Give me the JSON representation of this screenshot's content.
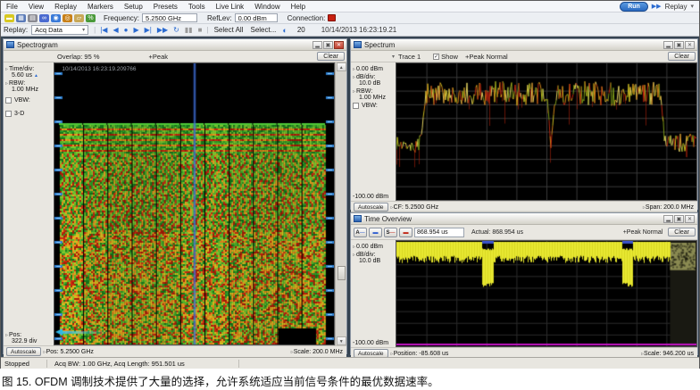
{
  "icons": {
    "caret": "▾",
    "check": "✓",
    "disc": "▹",
    "spin_up": "▲",
    "spin_down": "▼",
    "half_circle": "◐",
    "replay_play": "▶▶",
    "scroll_up": "▲",
    "scroll_down": "▼",
    "dropdown_caret": "▾"
  },
  "menu": {
    "items": [
      "File",
      "View",
      "Replay",
      "Markers",
      "Setup",
      "Presets",
      "Tools",
      "Live Link",
      "Window",
      "Help"
    ],
    "run_button": "Run",
    "replay_button": "Replay"
  },
  "toolbar_icons": [
    {
      "glyph": "▬",
      "name": "marker-peak",
      "color": "#d8c820"
    },
    {
      "glyph": "▦",
      "name": "save",
      "color": "#5a7ab8"
    },
    {
      "glyph": "▤",
      "name": "print",
      "color": "#8a8a92"
    },
    {
      "glyph": "∞",
      "name": "link",
      "color": "#4a6ad0"
    },
    {
      "glyph": "◉",
      "name": "acquire",
      "color": "#3a7ad8"
    },
    {
      "glyph": "◎",
      "name": "search",
      "color": "#c88018"
    },
    {
      "glyph": "▱",
      "name": "folder",
      "color": "#c8a858"
    },
    {
      "glyph": "%",
      "name": "percent",
      "color": "#4a9a3a"
    }
  ],
  "toolbar": {
    "frequency_label": "Frequency:",
    "frequency_value": "5.2500 GHz",
    "reflev_label": "RefLev:",
    "reflev_value": "0.00 dBm",
    "connection_label": "Connection:"
  },
  "replay_bar": {
    "label": "Replay:",
    "source": "Acq Data",
    "transport": [
      {
        "glyph": "|◀",
        "name": "skip-start",
        "color": "#2a6ad0"
      },
      {
        "glyph": "◀",
        "name": "step-back",
        "color": "#2a6ad0"
      },
      {
        "glyph": "●",
        "name": "record",
        "color": "#2a6ad0"
      },
      {
        "glyph": "▶",
        "name": "play",
        "color": "#2a6ad0"
      },
      {
        "glyph": "▶|",
        "name": "skip-end",
        "color": "#2a6ad0"
      },
      {
        "glyph": "▶▶",
        "name": "fast-forward",
        "color": "#2a6ad0"
      },
      {
        "glyph": "↻",
        "name": "loop",
        "color": "#2a6ad0"
      },
      {
        "glyph": "▮▮",
        "name": "pause",
        "color": "#9a9a9a"
      },
      {
        "glyph": "■",
        "name": "stop",
        "color": "#9a9a9a"
      }
    ],
    "select_all": "Select All",
    "select_more": "Select...",
    "count": "20",
    "timestamp": "10/14/2013 16:23:19.21"
  },
  "spectrogram": {
    "title": "Spectrogram",
    "overlap": "Overlap: 95 %",
    "detector": "+Peak",
    "clear": "Clear",
    "plot_timestamp": "10/14/2013 16:23:19.209766",
    "sidebar": {
      "time_div_label": "Time/div:",
      "time_div_value": "5.60 us",
      "rbw_label": "RBW:",
      "rbw_value": "1.00 MHz",
      "vbw_label": "VBW:",
      "threed_label": "3-D",
      "pos_label": "Pos:",
      "pos_value": "322.9 div"
    },
    "autoscale": "Autoscale",
    "bottom": {
      "pos": "Pos:  5.2500 GHz",
      "scale": "Scale:  200.0 MHz"
    }
  },
  "spectrum": {
    "title": "Spectrum",
    "trace_label": "Trace 1",
    "show_label": "Show",
    "detector": "+Peak Normal",
    "clear": "Clear",
    "sidebar": {
      "ref_top": "0.00 dBm",
      "db_div_label": "dB/div:",
      "db_div_value": "10.0 dB",
      "rbw_label": "RBW:",
      "rbw_value": "1.00 MHz",
      "vbw_label": "VBW:",
      "ref_bottom": "-100.00 dBm"
    },
    "autoscale": "Autoscale",
    "bottom": {
      "cf": "CF:  5.2500 GHz",
      "span": "Span:  200.0 MHz"
    }
  },
  "time_overview": {
    "title": "Time Overview",
    "analysis_value": "868.954 us",
    "actual_label": "Actual:  868.954 us",
    "detector": "+Peak Normal",
    "clear": "Clear",
    "sidebar": {
      "ref_top": "0.00 dBm",
      "db_div_label": "dB/div:",
      "db_div_value": "10.0 dB",
      "ref_bottom": "-100.00 dBm"
    },
    "autoscale": "Autoscale",
    "bottom": {
      "position": "Position:  -85.608 us",
      "scale": "Scale:  946.200 us"
    }
  },
  "status_bar": {
    "state": "Stopped",
    "acq": "Acq BW: 1.00 GHz, Acq Length: 951.501 us"
  },
  "caption": "图 15. OFDM 调制技术提供了大量的选择，允许系统适应当前信号条件的最优数据速率。",
  "chart_data": [
    {
      "id": "spectrogram",
      "type": "heatmap",
      "title": "Spectrogram",
      "x_center": "5.2500 GHz",
      "x_scale_per_div": "200.0 MHz",
      "time_per_div": "5.60 us",
      "overlap_pct": 95,
      "detector": "+Peak",
      "description": "OFDM burst: 11 subchannel column groups, preamble ladder band, pilot squiggle band, dense payload speckle; blue time ticks on both edges; blue center-frequency cursor",
      "greens": [
        "#157a1c",
        "#2f9e28",
        "#58b82a",
        "#7ec830"
      ],
      "hots": [
        "#e0861a",
        "#cc2810",
        "#a81c08",
        "#e8a020"
      ],
      "tick_color": "#2f7fd0",
      "cursor_color": "#4a7ae0",
      "signal_top_frac": 0.22
    },
    {
      "id": "spectrum",
      "type": "line",
      "title": "Spectrum",
      "cf": "5.2500 GHz",
      "span": "200.0 MHz",
      "ylim_dbm": [
        -100,
        0
      ],
      "db_per_div": 10,
      "rbw": "1.00 MHz",
      "plateau_frac": 0.22,
      "floor_frac": 0.6,
      "edge_left": 0.085,
      "edge_right": 0.885,
      "notch": 0.515,
      "grid": true,
      "palette": [
        "#c8b820",
        "#d08018",
        "#b82810",
        "#7a9818",
        "#e0d060"
      ]
    },
    {
      "id": "time_overview",
      "type": "area",
      "title": "Time Overview",
      "position": "-85.608 us",
      "scale": "946.200 us",
      "ylim_dbm": [
        -100,
        0
      ],
      "db_per_div": 10,
      "band_bottom_frac": 0.14,
      "dropouts": [
        {
          "s": 0.285,
          "e": 0.322,
          "bottom_frac": 0.4
        },
        {
          "s": 0.752,
          "e": 0.788,
          "bottom_frac": 0.4
        }
      ],
      "acq_end": 0.912,
      "band_color": "#e8e832",
      "beyond_color": "#8a8a52",
      "marker_line_color": "#c414c4",
      "dropout_cap_color": "#3a52c8",
      "grid": true
    }
  ]
}
